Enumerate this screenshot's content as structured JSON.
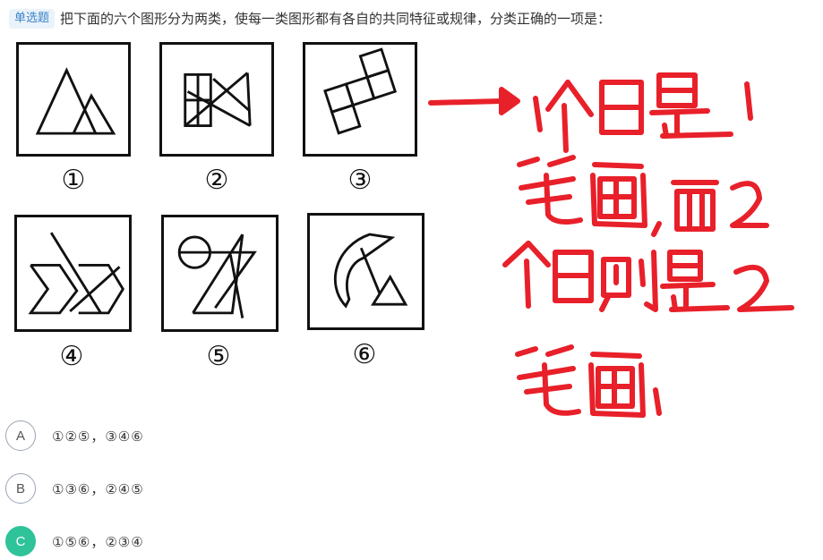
{
  "question": {
    "type_tag": "单选题",
    "stem": "把下面的六个图形分为两类，使每一类图形都有各自的共同特征或规律，分类正确的一项是："
  },
  "figures": [
    {
      "number": "①"
    },
    {
      "number": "②"
    },
    {
      "number": "③"
    },
    {
      "number": "④"
    },
    {
      "number": "⑤"
    },
    {
      "number": "⑥"
    }
  ],
  "options": [
    {
      "letter": "A",
      "text": "①②⑤，③④⑥",
      "selected": false
    },
    {
      "letter": "B",
      "text": "①③⑥，②④⑤",
      "selected": false
    },
    {
      "letter": "C",
      "text": "①⑤⑥，②③④",
      "selected": true
    }
  ],
  "annotation": {
    "text": "1个日是1笔画，而2个日则是2笔画",
    "ink_color": "#e8202a"
  },
  "colors": {
    "tag_text": "#3b82c4",
    "tag_bg": "#eaf3fb",
    "selected_option": "#2fc39a"
  }
}
